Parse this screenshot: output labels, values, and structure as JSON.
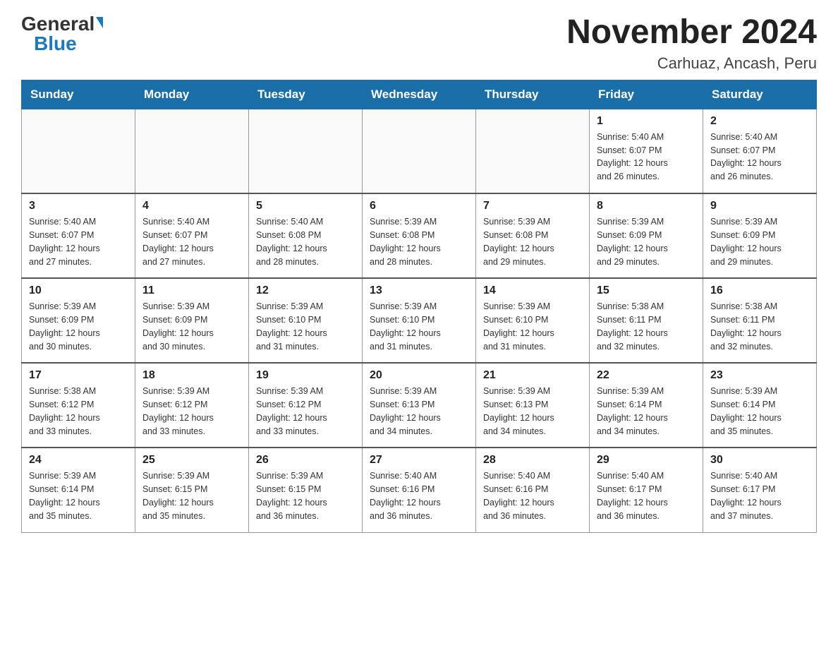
{
  "header": {
    "logo_general": "General",
    "logo_blue": "Blue",
    "month_title": "November 2024",
    "location": "Carhuaz, Ancash, Peru"
  },
  "days_of_week": [
    "Sunday",
    "Monday",
    "Tuesday",
    "Wednesday",
    "Thursday",
    "Friday",
    "Saturday"
  ],
  "weeks": [
    [
      {
        "day": "",
        "info": ""
      },
      {
        "day": "",
        "info": ""
      },
      {
        "day": "",
        "info": ""
      },
      {
        "day": "",
        "info": ""
      },
      {
        "day": "",
        "info": ""
      },
      {
        "day": "1",
        "info": "Sunrise: 5:40 AM\nSunset: 6:07 PM\nDaylight: 12 hours\nand 26 minutes."
      },
      {
        "day": "2",
        "info": "Sunrise: 5:40 AM\nSunset: 6:07 PM\nDaylight: 12 hours\nand 26 minutes."
      }
    ],
    [
      {
        "day": "3",
        "info": "Sunrise: 5:40 AM\nSunset: 6:07 PM\nDaylight: 12 hours\nand 27 minutes."
      },
      {
        "day": "4",
        "info": "Sunrise: 5:40 AM\nSunset: 6:07 PM\nDaylight: 12 hours\nand 27 minutes."
      },
      {
        "day": "5",
        "info": "Sunrise: 5:40 AM\nSunset: 6:08 PM\nDaylight: 12 hours\nand 28 minutes."
      },
      {
        "day": "6",
        "info": "Sunrise: 5:39 AM\nSunset: 6:08 PM\nDaylight: 12 hours\nand 28 minutes."
      },
      {
        "day": "7",
        "info": "Sunrise: 5:39 AM\nSunset: 6:08 PM\nDaylight: 12 hours\nand 29 minutes."
      },
      {
        "day": "8",
        "info": "Sunrise: 5:39 AM\nSunset: 6:09 PM\nDaylight: 12 hours\nand 29 minutes."
      },
      {
        "day": "9",
        "info": "Sunrise: 5:39 AM\nSunset: 6:09 PM\nDaylight: 12 hours\nand 29 minutes."
      }
    ],
    [
      {
        "day": "10",
        "info": "Sunrise: 5:39 AM\nSunset: 6:09 PM\nDaylight: 12 hours\nand 30 minutes."
      },
      {
        "day": "11",
        "info": "Sunrise: 5:39 AM\nSunset: 6:09 PM\nDaylight: 12 hours\nand 30 minutes."
      },
      {
        "day": "12",
        "info": "Sunrise: 5:39 AM\nSunset: 6:10 PM\nDaylight: 12 hours\nand 31 minutes."
      },
      {
        "day": "13",
        "info": "Sunrise: 5:39 AM\nSunset: 6:10 PM\nDaylight: 12 hours\nand 31 minutes."
      },
      {
        "day": "14",
        "info": "Sunrise: 5:39 AM\nSunset: 6:10 PM\nDaylight: 12 hours\nand 31 minutes."
      },
      {
        "day": "15",
        "info": "Sunrise: 5:38 AM\nSunset: 6:11 PM\nDaylight: 12 hours\nand 32 minutes."
      },
      {
        "day": "16",
        "info": "Sunrise: 5:38 AM\nSunset: 6:11 PM\nDaylight: 12 hours\nand 32 minutes."
      }
    ],
    [
      {
        "day": "17",
        "info": "Sunrise: 5:38 AM\nSunset: 6:12 PM\nDaylight: 12 hours\nand 33 minutes."
      },
      {
        "day": "18",
        "info": "Sunrise: 5:39 AM\nSunset: 6:12 PM\nDaylight: 12 hours\nand 33 minutes."
      },
      {
        "day": "19",
        "info": "Sunrise: 5:39 AM\nSunset: 6:12 PM\nDaylight: 12 hours\nand 33 minutes."
      },
      {
        "day": "20",
        "info": "Sunrise: 5:39 AM\nSunset: 6:13 PM\nDaylight: 12 hours\nand 34 minutes."
      },
      {
        "day": "21",
        "info": "Sunrise: 5:39 AM\nSunset: 6:13 PM\nDaylight: 12 hours\nand 34 minutes."
      },
      {
        "day": "22",
        "info": "Sunrise: 5:39 AM\nSunset: 6:14 PM\nDaylight: 12 hours\nand 34 minutes."
      },
      {
        "day": "23",
        "info": "Sunrise: 5:39 AM\nSunset: 6:14 PM\nDaylight: 12 hours\nand 35 minutes."
      }
    ],
    [
      {
        "day": "24",
        "info": "Sunrise: 5:39 AM\nSunset: 6:14 PM\nDaylight: 12 hours\nand 35 minutes."
      },
      {
        "day": "25",
        "info": "Sunrise: 5:39 AM\nSunset: 6:15 PM\nDaylight: 12 hours\nand 35 minutes."
      },
      {
        "day": "26",
        "info": "Sunrise: 5:39 AM\nSunset: 6:15 PM\nDaylight: 12 hours\nand 36 minutes."
      },
      {
        "day": "27",
        "info": "Sunrise: 5:40 AM\nSunset: 6:16 PM\nDaylight: 12 hours\nand 36 minutes."
      },
      {
        "day": "28",
        "info": "Sunrise: 5:40 AM\nSunset: 6:16 PM\nDaylight: 12 hours\nand 36 minutes."
      },
      {
        "day": "29",
        "info": "Sunrise: 5:40 AM\nSunset: 6:17 PM\nDaylight: 12 hours\nand 36 minutes."
      },
      {
        "day": "30",
        "info": "Sunrise: 5:40 AM\nSunset: 6:17 PM\nDaylight: 12 hours\nand 37 minutes."
      }
    ]
  ]
}
